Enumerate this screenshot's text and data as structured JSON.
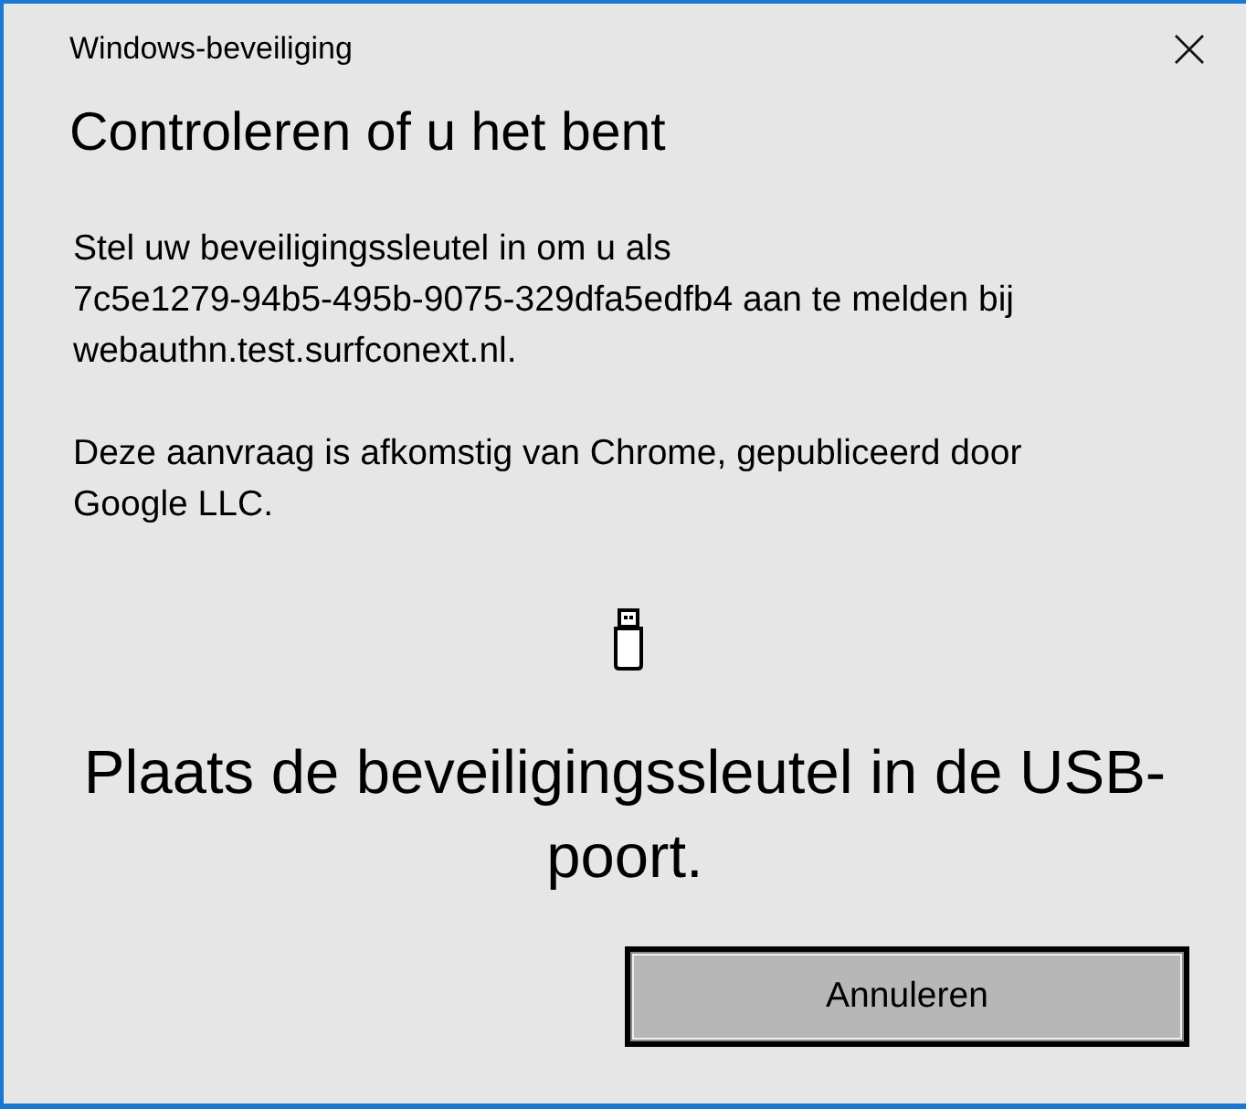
{
  "window": {
    "title": "Windows-beveiliging"
  },
  "heading": "Controleren of u het bent",
  "message": [
    "Stel uw beveiligingssleutel in om u als\n7c5e1279-94b5-495b-9075-329dfa5edfb4 aan te melden bij\nwebauthn.test.surfconext.nl.",
    "Deze aanvraag is afkomstig van Chrome, gepubliceerd door\nGoogle LLC."
  ],
  "prompt": "Plaats de beveiligingssleutel in de USB-poort.",
  "buttons": [
    {
      "label": "Annuleren",
      "focused": true
    }
  ]
}
